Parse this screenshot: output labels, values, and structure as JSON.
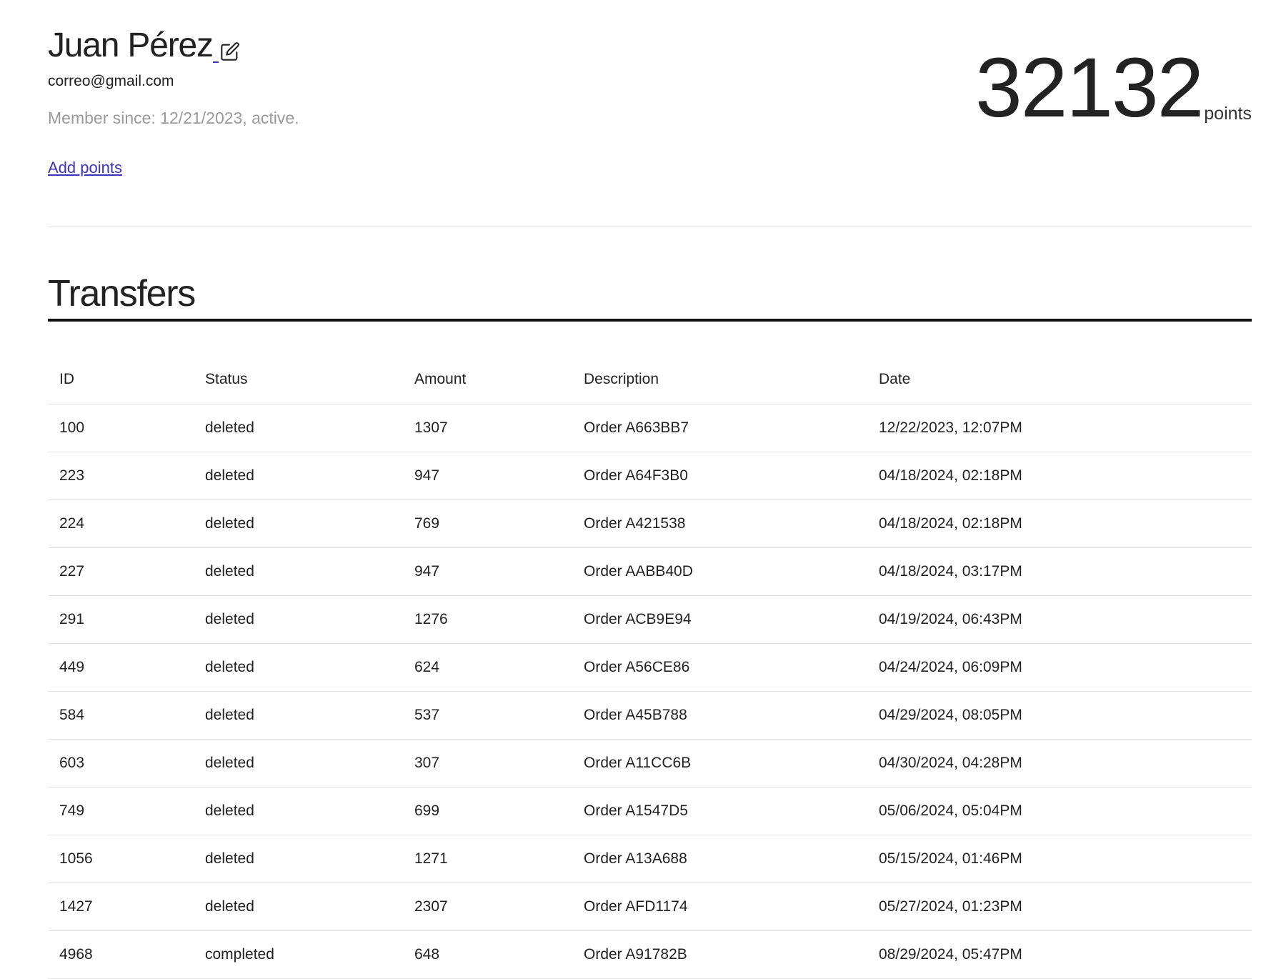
{
  "profile": {
    "name": "Juan Pérez",
    "email": "correo@gmail.com",
    "member_since": "Member since: 12/21/2023, active."
  },
  "actions": {
    "add_points": "Add points"
  },
  "points": {
    "value": "32132",
    "label": "points"
  },
  "transfers": {
    "title": "Transfers",
    "columns": [
      "ID",
      "Status",
      "Amount",
      "Description",
      "Date"
    ],
    "rows": [
      {
        "id": "100",
        "status": "deleted",
        "amount": "1307",
        "description": "Order A663BB7",
        "date": "12/22/2023, 12:07PM"
      },
      {
        "id": "223",
        "status": "deleted",
        "amount": "947",
        "description": "Order A64F3B0",
        "date": "04/18/2024, 02:18PM"
      },
      {
        "id": "224",
        "status": "deleted",
        "amount": "769",
        "description": "Order A421538",
        "date": "04/18/2024, 02:18PM"
      },
      {
        "id": "227",
        "status": "deleted",
        "amount": "947",
        "description": "Order AABB40D",
        "date": "04/18/2024, 03:17PM"
      },
      {
        "id": "291",
        "status": "deleted",
        "amount": "1276",
        "description": "Order ACB9E94",
        "date": "04/19/2024, 06:43PM"
      },
      {
        "id": "449",
        "status": "deleted",
        "amount": "624",
        "description": "Order A56CE86",
        "date": "04/24/2024, 06:09PM"
      },
      {
        "id": "584",
        "status": "deleted",
        "amount": "537",
        "description": "Order A45B788",
        "date": "04/29/2024, 08:05PM"
      },
      {
        "id": "603",
        "status": "deleted",
        "amount": "307",
        "description": "Order A11CC6B",
        "date": "04/30/2024, 04:28PM"
      },
      {
        "id": "749",
        "status": "deleted",
        "amount": "699",
        "description": "Order A1547D5",
        "date": "05/06/2024, 05:04PM"
      },
      {
        "id": "1056",
        "status": "deleted",
        "amount": "1271",
        "description": "Order A13A688",
        "date": "05/15/2024, 01:46PM"
      },
      {
        "id": "1427",
        "status": "deleted",
        "amount": "2307",
        "description": "Order AFD1174",
        "date": "05/27/2024, 01:23PM"
      },
      {
        "id": "4968",
        "status": "completed",
        "amount": "648",
        "description": "Order A91782B",
        "date": "08/29/2024, 05:47PM"
      }
    ]
  },
  "icons": {
    "edit": "edit-icon"
  },
  "colors": {
    "link": "#3b33b8",
    "muted": "#9a9a9a",
    "text": "#222222"
  }
}
